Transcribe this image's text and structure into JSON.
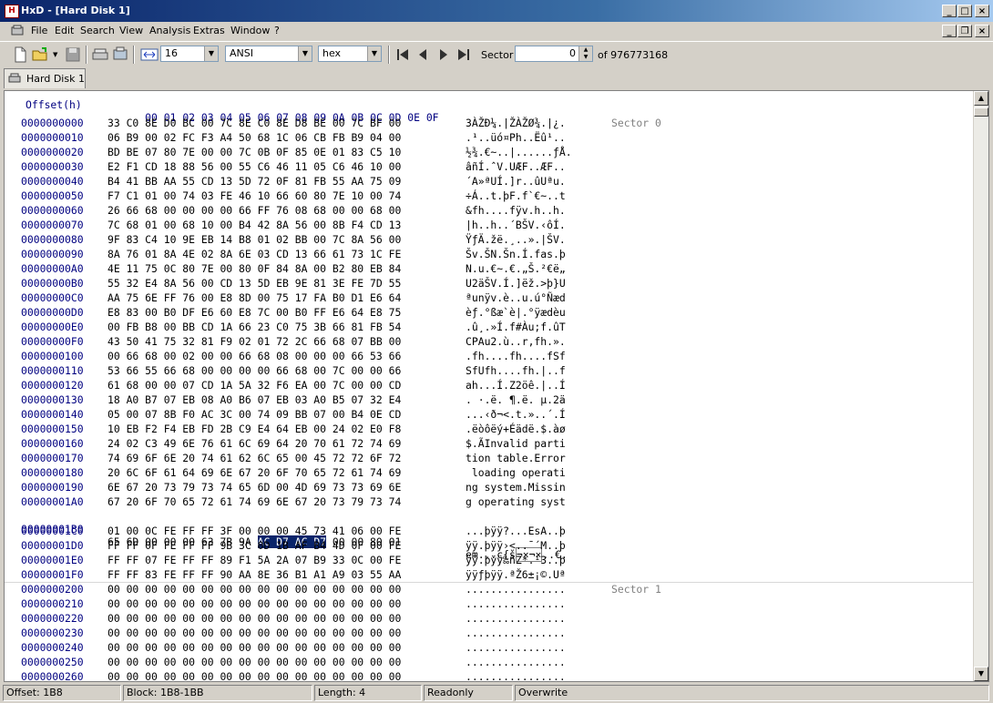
{
  "window": {
    "title": "HxD - [Hard Disk 1]"
  },
  "menu": [
    "File",
    "Edit",
    "Search",
    "View",
    "Analysis",
    "Extras",
    "Window",
    "?"
  ],
  "toolbar": {
    "bytes_per_row": "16",
    "charset": "ANSI",
    "offset_base": "hex",
    "sector_label": "Sector",
    "sector_value": "0",
    "sector_total": "of 976773168"
  },
  "tab": {
    "label": "Hard Disk 1"
  },
  "header": {
    "offset_label": "Offset(h)",
    "columns": [
      "00",
      "01",
      "02",
      "03",
      "04",
      "05",
      "06",
      "07",
      "08",
      "09",
      "0A",
      "0B",
      "0C",
      "0D",
      "0E",
      "0F"
    ]
  },
  "sectors": [
    "Sector 0",
    "Sector 1"
  ],
  "rows": [
    {
      "off": "0000000000",
      "hex": "33 C0 8E D0 BC 00 7C 8E C0 8E D8 BE 00 7C BF 00",
      "asc": "3ÀŽĐ¼.|ŽÀŽØ¾.|¿."
    },
    {
      "off": "0000000010",
      "hex": "06 B9 00 02 FC F3 A4 50 68 1C 06 CB FB B9 04 00",
      "asc": ".¹..üó¤Ph..Ëû¹.."
    },
    {
      "off": "0000000020",
      "hex": "BD BE 07 80 7E 00 00 7C 0B 0F 85 0E 01 83 C5 10",
      "asc": "½¾.€~..|......ƒÅ."
    },
    {
      "off": "0000000030",
      "hex": "E2 F1 CD 18 88 56 00 55 C6 46 11 05 C6 46 10 00",
      "asc": "âñÍ.ˆV.UÆF..ÆF.."
    },
    {
      "off": "0000000040",
      "hex": "B4 41 BB AA 55 CD 13 5D 72 0F 81 FB 55 AA 75 09",
      "asc": "´A»ªUÍ.]r..ûUªu."
    },
    {
      "off": "0000000050",
      "hex": "F7 C1 01 00 74 03 FE 46 10 66 60 80 7E 10 00 74",
      "asc": "÷Á..t.þF.f`€~..t"
    },
    {
      "off": "0000000060",
      "hex": "26 66 68 00 00 00 00 66 FF 76 08 68 00 00 68 00",
      "asc": "&fh....fÿv.h..h."
    },
    {
      "off": "0000000070",
      "hex": "7C 68 01 00 68 10 00 B4 42 8A 56 00 8B F4 CD 13",
      "asc": "|h..h..´BŠV.‹ôÍ."
    },
    {
      "off": "0000000080",
      "hex": "9F 83 C4 10 9E EB 14 B8 01 02 BB 00 7C 8A 56 00",
      "asc": "ŸƒÄ.žë.¸..».|ŠV."
    },
    {
      "off": "0000000090",
      "hex": "8A 76 01 8A 4E 02 8A 6E 03 CD 13 66 61 73 1C FE",
      "asc": "Šv.ŠN.Šn.Í.fas.þ"
    },
    {
      "off": "00000000A0",
      "hex": "4E 11 75 0C 80 7E 00 80 0F 84 8A 00 B2 80 EB 84",
      "asc": "N.u.€~.€.„Š.²€ë„"
    },
    {
      "off": "00000000B0",
      "hex": "55 32 E4 8A 56 00 CD 13 5D EB 9E 81 3E FE 7D 55",
      "asc": "U2äŠV.Í.]ëž.>þ}U"
    },
    {
      "off": "00000000C0",
      "hex": "AA 75 6E FF 76 00 E8 8D 00 75 17 FA B0 D1 E6 64",
      "asc": "ªunÿv.è..u.ú°Ñæd"
    },
    {
      "off": "00000000D0",
      "hex": "E8 83 00 B0 DF E6 60 E8 7C 00 B0 FF E6 64 E8 75",
      "asc": "èƒ.°ßæ`è|.°ÿædèu"
    },
    {
      "off": "00000000E0",
      "hex": "00 FB B8 00 BB CD 1A 66 23 C0 75 3B 66 81 FB 54",
      "asc": ".û¸.»Í.f#Àu;f.ûT"
    },
    {
      "off": "00000000F0",
      "hex": "43 50 41 75 32 81 F9 02 01 72 2C 66 68 07 BB 00",
      "asc": "CPAu2.ù..r,fh.»."
    },
    {
      "off": "0000000100",
      "hex": "00 66 68 00 02 00 00 66 68 08 00 00 00 66 53 66",
      "asc": ".fh....fh....fSf"
    },
    {
      "off": "0000000110",
      "hex": "53 66 55 66 68 00 00 00 00 66 68 00 7C 00 00 66",
      "asc": "SfUfh....fh.|..f"
    },
    {
      "off": "0000000120",
      "hex": "61 68 00 00 07 CD 1A 5A 32 F6 EA 00 7C 00 00 CD",
      "asc": "ah...Í.Z2öê.|..Í"
    },
    {
      "off": "0000000130",
      "hex": "18 A0 B7 07 EB 08 A0 B6 07 EB 03 A0 B5 07 32 E4",
      "asc": ". ·.ë. ¶.ë. µ.2ä"
    },
    {
      "off": "0000000140",
      "hex": "05 00 07 8B F0 AC 3C 00 74 09 BB 07 00 B4 0E CD",
      "asc": "...‹ð¬<.t.»..´.Í"
    },
    {
      "off": "0000000150",
      "hex": "10 EB F2 F4 EB FD 2B C9 E4 64 EB 00 24 02 E0 F8",
      "asc": ".ëòôëý+Éädë.$.àø"
    },
    {
      "off": "0000000160",
      "hex": "24 02 C3 49 6E 76 61 6C 69 64 20 70 61 72 74 69",
      "asc": "$.ÃInvalid parti"
    },
    {
      "off": "0000000170",
      "hex": "74 69 6F 6E 20 74 61 62 6C 65 00 45 72 72 6F 72",
      "asc": "tion table.Error"
    },
    {
      "off": "0000000180",
      "hex": "20 6C 6F 61 64 69 6E 67 20 6F 70 65 72 61 74 69",
      "asc": " loading operati"
    },
    {
      "off": "0000000190",
      "hex": "6E 67 20 73 79 73 74 65 6D 00 4D 69 73 73 69 6E",
      "asc": "ng system.Missin"
    },
    {
      "off": "00000001A0",
      "hex": "67 20 6F 70 65 72 61 74 69 6E 67 20 73 79 73 74",
      "asc": "g operating syst"
    },
    {
      "off": "00000001B0",
      "hex_pre": "65 6D 00 00 00 63 7B 9A ",
      "hex_sel": "AC D7 AC D7",
      "hex_post": " 00 00 80 01",
      "asc_pre": "em...c{š",
      "asc_sel": "¬×¬×",
      "asc_post": "..€."
    },
    {
      "off": "00000001C0",
      "hex": "01 00 0C FE FF FF 3F 00 00 00 45 73 41 06 00 FE",
      "asc": "...þÿÿ?...EsA..þ"
    },
    {
      "off": "00000001D0",
      "hex": "FF FF 0F FE FF FF 9B 3C 0D 1B AF B4 4D 0F 00 FE",
      "asc": "ÿÿ.þÿÿ›<..¯´M..þ"
    },
    {
      "off": "00000001E0",
      "hex": "FF FF 07 FE FF FF 89 F1 5A 2A 07 B9 33 0C 00 FE",
      "asc": "ÿÿ.þÿÿ‰ñZ*.¹3..þ"
    },
    {
      "off": "00000001F0",
      "hex": "FF FF 83 FE FF FF 90 AA 8E 36 B1 A1 A9 03 55 AA",
      "asc": "ÿÿƒþÿÿ.ªŽ6±¡©.Uª"
    },
    {
      "off": "0000000200",
      "hex": "00 00 00 00 00 00 00 00 00 00 00 00 00 00 00 00",
      "asc": "................"
    },
    {
      "off": "0000000210",
      "hex": "00 00 00 00 00 00 00 00 00 00 00 00 00 00 00 00",
      "asc": "................"
    },
    {
      "off": "0000000220",
      "hex": "00 00 00 00 00 00 00 00 00 00 00 00 00 00 00 00",
      "asc": "................"
    },
    {
      "off": "0000000230",
      "hex": "00 00 00 00 00 00 00 00 00 00 00 00 00 00 00 00",
      "asc": "................"
    },
    {
      "off": "0000000240",
      "hex": "00 00 00 00 00 00 00 00 00 00 00 00 00 00 00 00",
      "asc": "................"
    },
    {
      "off": "0000000250",
      "hex": "00 00 00 00 00 00 00 00 00 00 00 00 00 00 00 00",
      "asc": "................"
    },
    {
      "off": "0000000260",
      "hex": "00 00 00 00 00 00 00 00 00 00 00 00 00 00 00 00",
      "asc": "................"
    }
  ],
  "status": {
    "offset": "Offset: 1B8",
    "block": "Block: 1B8-1BB",
    "length": "Length: 4",
    "mode": "Readonly",
    "insert": "Overwrite"
  }
}
